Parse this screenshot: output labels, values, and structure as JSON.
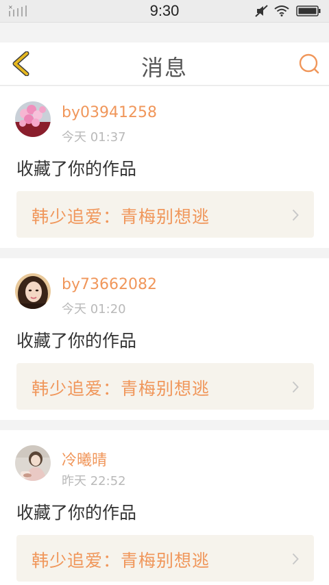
{
  "status_bar": {
    "time": "9:30",
    "signal_icon": "signal-x-icon",
    "mute_icon": "mute-icon",
    "wifi_icon": "wifi-icon",
    "battery_icon": "battery-icon"
  },
  "header": {
    "title": "消息",
    "back_icon": "chevron-left-icon",
    "search_icon": "search-icon"
  },
  "colors": {
    "accent": "#f0965a",
    "back_icon": "#e6b820",
    "work_background": "#f6f3ec"
  },
  "messages": [
    {
      "username": "by03941258",
      "time": "今天 01:37",
      "action": "收藏了你的作品",
      "work_title": "韩少追爱：青梅别想逃",
      "avatar": "pink-balloons-avatar"
    },
    {
      "username": "by73662082",
      "time": "今天 01:20",
      "action": "收藏了你的作品",
      "work_title": "韩少追爱：青梅别想逃",
      "avatar": "woman-portrait-avatar"
    },
    {
      "username": "冷曦晴",
      "time": "昨天 22:52",
      "action": "收藏了你的作品",
      "work_title": "韩少追爱：青梅别想逃",
      "avatar": "girl-photo-avatar"
    }
  ]
}
